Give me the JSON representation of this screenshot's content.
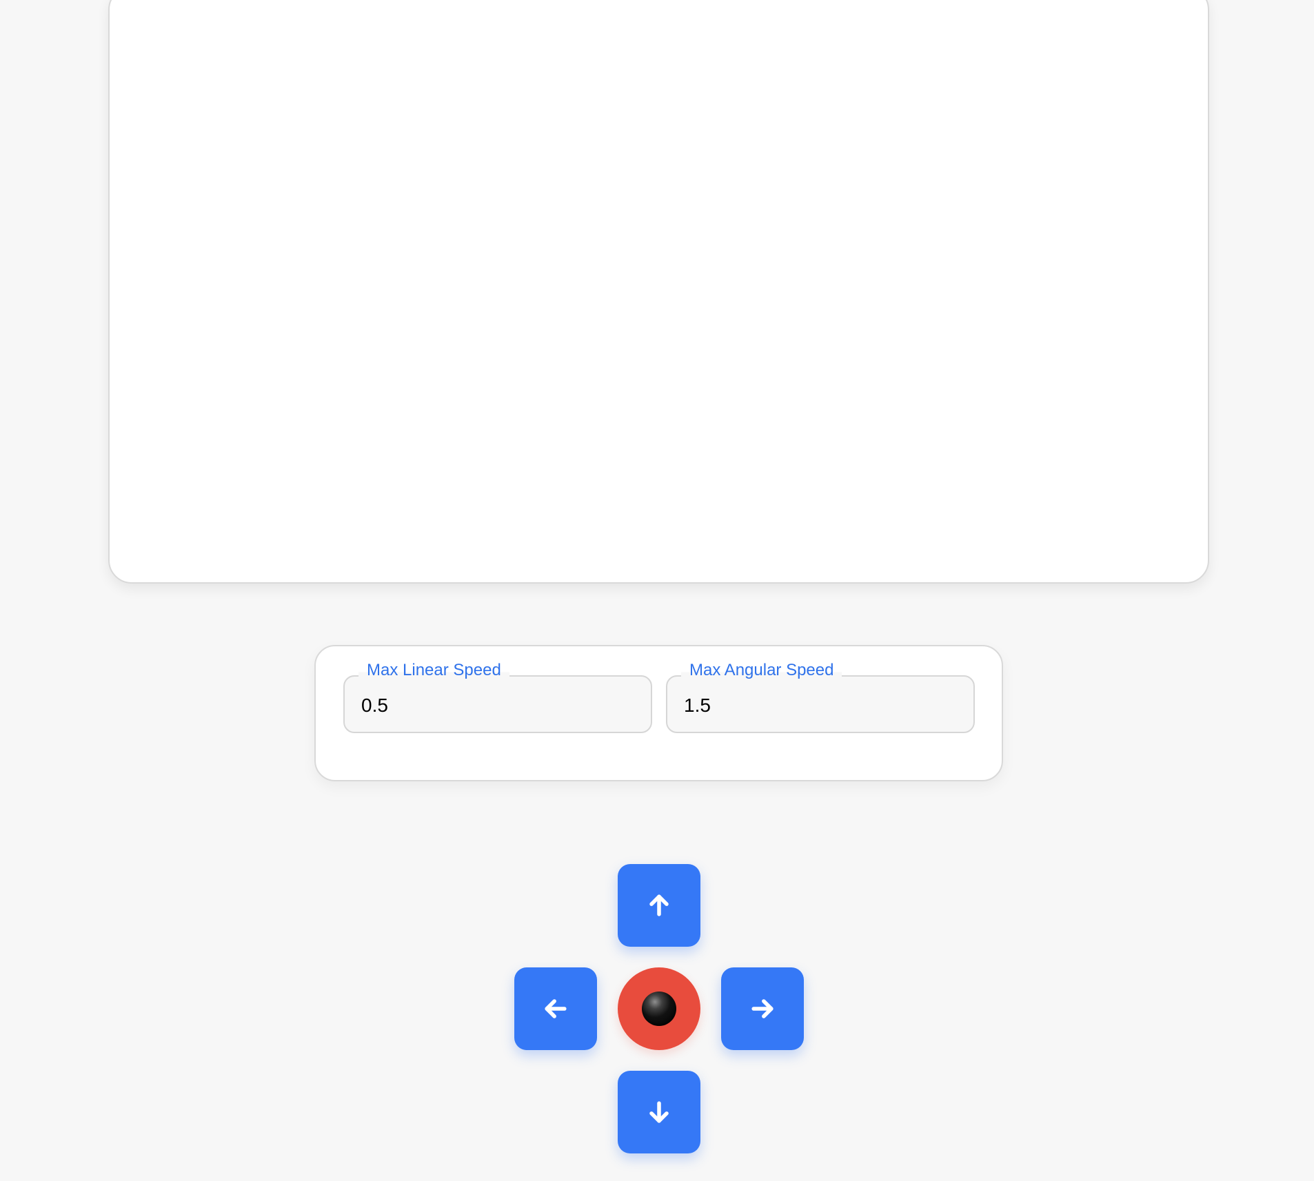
{
  "settings": {
    "linear": {
      "label": "Max Linear Speed",
      "value": "0.5"
    },
    "angular": {
      "label": "Max Angular Speed",
      "value": "1.5"
    }
  },
  "controls": {
    "up_icon": "arrow-up-icon",
    "left_icon": "arrow-left-icon",
    "right_icon": "arrow-right-icon",
    "down_icon": "arrow-down-icon",
    "stop_icon": "black-circle-icon"
  },
  "colors": {
    "accent": "#3578f6",
    "label": "#2f72ea",
    "stop": "#e84c3d",
    "background": "#f7f7f7",
    "panel": "#ffffff"
  }
}
